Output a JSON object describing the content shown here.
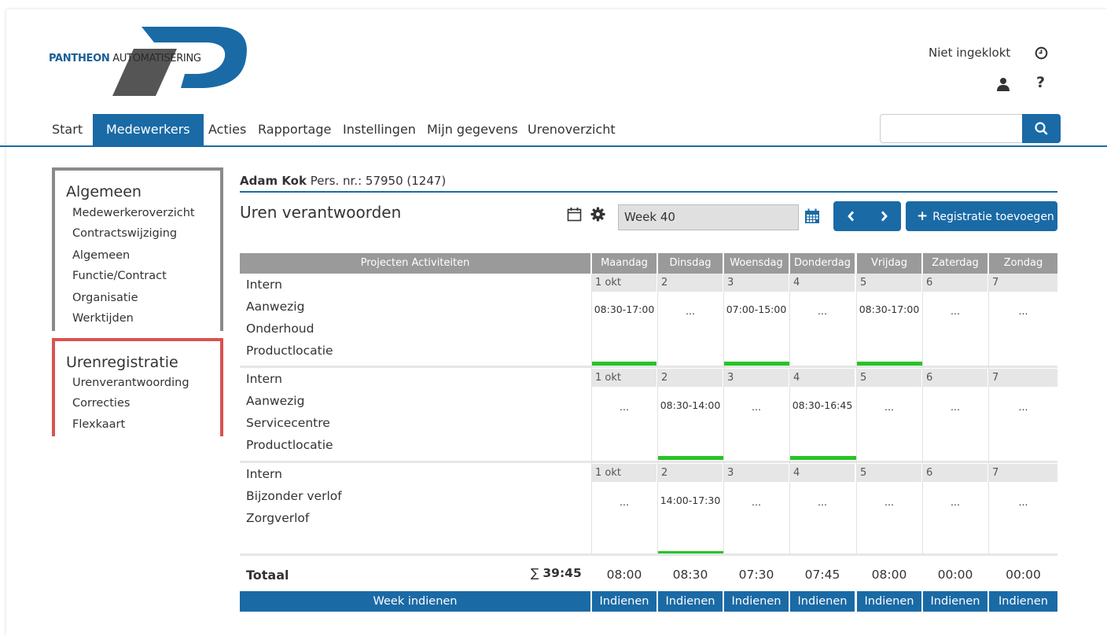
{
  "brand": {
    "name_bold": "PANTHEON",
    "name_rest": "AUTOMATISERING",
    "primary_color": "#1a6aa6",
    "dark_color": "#4a4a4a"
  },
  "header": {
    "status": "Niet ingeklokt",
    "help": "?"
  },
  "nav": {
    "items": [
      "Start",
      "Medewerkers",
      "Acties",
      "Rapportage",
      "Instellingen",
      "Mijn gegevens",
      "Urenoverzicht"
    ],
    "active": "Medewerkers",
    "search_value": ""
  },
  "sidebar": {
    "algemeen": {
      "title": "Algemeen",
      "items": [
        "Medewerkeroverzicht",
        "Contractswijziging",
        "Algemeen",
        "Functie/Contract",
        "Organisatie",
        "Werktijden"
      ]
    },
    "urenregistratie": {
      "title": "Urenregistratie",
      "items": [
        "Urenverantwoording",
        "Correcties",
        "Flexkaart"
      ]
    }
  },
  "employee": {
    "name": "Adam Kok",
    "pers": "Pers. nr.: 57950 (1247)"
  },
  "page": {
    "title": "Uren verantwoorden",
    "week": "Week 40",
    "add_label": "Registratie toevoegen"
  },
  "grid": {
    "header_left": "Projecten   Activiteiten",
    "days": [
      "Maandag",
      "Dinsdag",
      "Woensdag",
      "Donderdag",
      "Vrijdag",
      "Zaterdag",
      "Zondag"
    ],
    "dates": [
      "1 okt",
      "2",
      "3",
      "4",
      "5",
      "6",
      "7"
    ],
    "rows": [
      {
        "labels": [
          "Intern",
          "Aanwezig",
          "Onderhoud",
          "Productlocatie"
        ],
        "cells": [
          "08:30-17:00",
          "...",
          "07:00-15:00",
          "...",
          "08:30-17:00",
          "...",
          "..."
        ],
        "green": [
          true,
          false,
          true,
          false,
          true,
          false,
          false
        ]
      },
      {
        "labels": [
          "Intern",
          "Aanwezig",
          "Servicecentre",
          "Productlocatie"
        ],
        "cells": [
          "...",
          "08:30-14:00",
          "...",
          "08:30-16:45",
          "...",
          "...",
          "..."
        ],
        "green": [
          false,
          true,
          false,
          true,
          false,
          false,
          false
        ]
      },
      {
        "labels": [
          "Intern",
          "Bijzonder verlof",
          "Zorgverlof"
        ],
        "cells": [
          "...",
          "14:00-17:30",
          "...",
          "...",
          "...",
          "...",
          "..."
        ],
        "green": [
          false,
          true,
          false,
          false,
          false,
          false,
          false
        ]
      }
    ],
    "total_label": "Totaal",
    "total_sum_symbol": "∑",
    "total_sum": "39:45",
    "totals": [
      "08:00",
      "08:30",
      "07:30",
      "07:45",
      "08:00",
      "00:00",
      "00:00"
    ],
    "week_submit": "Week indienen",
    "day_submit": "Indienen"
  }
}
